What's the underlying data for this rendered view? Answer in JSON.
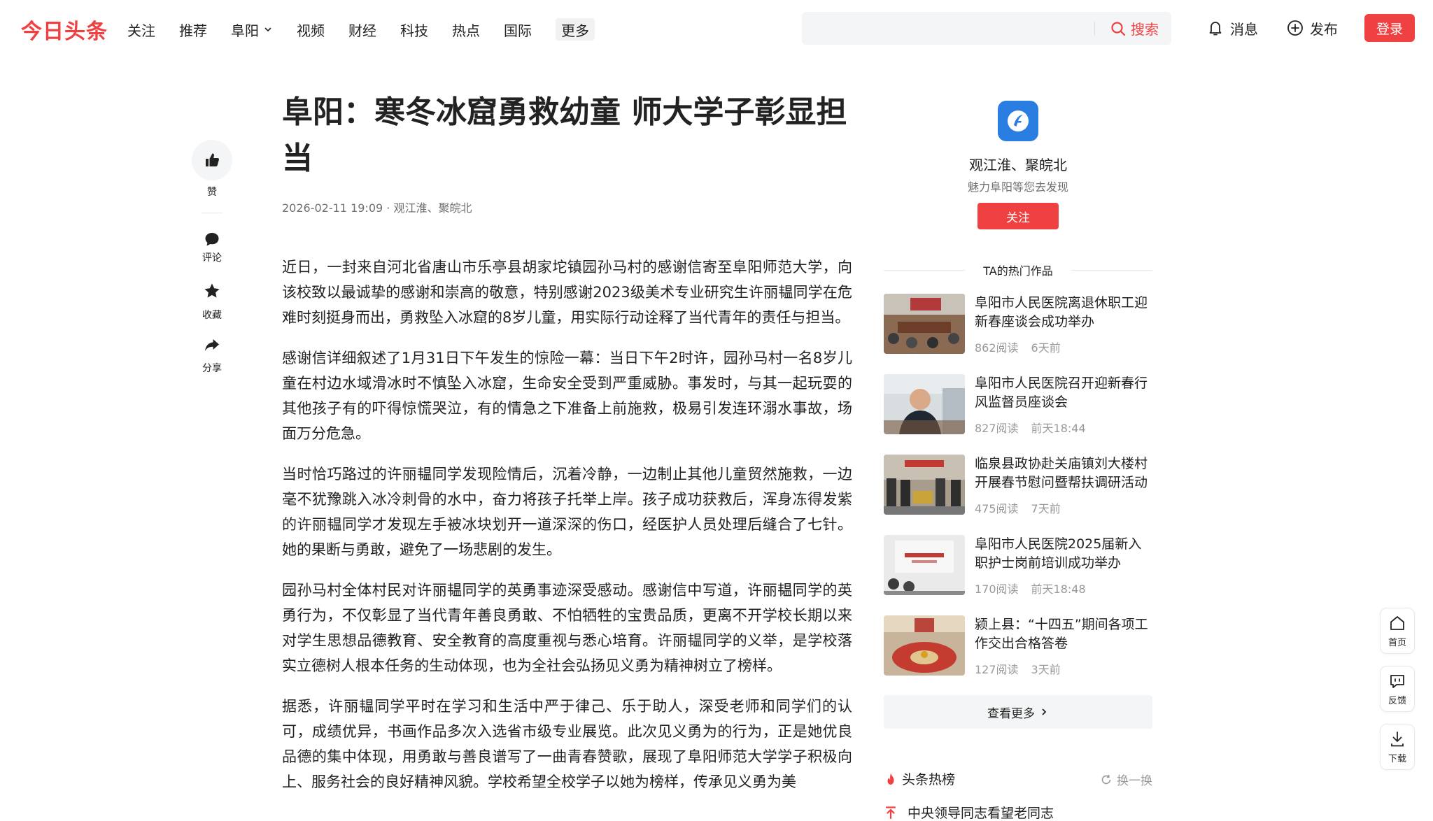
{
  "header": {
    "logo": "今日头条",
    "nav": [
      "关注",
      "推荐",
      "阜阳",
      "视频",
      "财经",
      "科技",
      "热点",
      "国际",
      "更多"
    ],
    "search": {
      "placeholder": "",
      "button": "搜索"
    },
    "messages": "消息",
    "publish": "发布",
    "login": "登录"
  },
  "rail": {
    "like": "赞",
    "comment": "评论",
    "collect": "收藏",
    "share": "分享"
  },
  "article": {
    "title": "阜阳：寒冬冰窟勇救幼童 师大学子彰显担当",
    "date": "2026-02-11 19:09",
    "source": "观江淮、聚皖北",
    "paragraphs": [
      "近日，一封来自河北省唐山市乐亭县胡家坨镇园孙马村的感谢信寄至阜阳师范大学，向该校致以最诚挚的感谢和崇高的敬意，特别感谢2023级美术专业研究生许丽韫同学在危难时刻挺身而出，勇救坠入冰窟的8岁儿童，用实际行动诠释了当代青年的责任与担当。",
      "感谢信详细叙述了1月31日下午发生的惊险一幕：当日下午2时许，园孙马村一名8岁儿童在村边水域滑冰时不慎坠入冰窟，生命安全受到严重威胁。事发时，与其一起玩耍的其他孩子有的吓得惊慌哭泣，有的情急之下准备上前施救，极易引发连环溺水事故，场面万分危急。",
      "当时恰巧路过的许丽韫同学发现险情后，沉着冷静，一边制止其他儿童贸然施救，一边毫不犹豫跳入冰冷刺骨的水中，奋力将孩子托举上岸。孩子成功获救后，浑身冻得发紫的许丽韫同学才发现左手被冰块划开一道深深的伤口，经医护人员处理后缝合了七针。她的果断与勇敢，避免了一场悲剧的发生。",
      "园孙马村全体村民对许丽韫同学的英勇事迹深受感动。感谢信中写道，许丽韫同学的英勇行为，不仅彰显了当代青年善良勇敢、不怕牺牲的宝贵品质，更离不开学校长期以来对学生思想品德教育、安全教育的高度重视与悉心培育。许丽韫同学的义举，是学校落实立德树人根本任务的生动体现，也为全社会弘扬见义勇为精神树立了榜样。",
      "据悉，许丽韫同学平时在学习和生活中严于律己、乐于助人，深受老师和同学们的认可，成绩优异，书画作品多次入选省市级专业展览。此次见义勇为的行为，正是她优良品德的集中体现，用勇敢与善良谱写了一曲青春赞歌，展现了阜阳师范大学学子积极向上、服务社会的良好精神风貌。学校希望全校学子以她为榜样，传承见义勇为美"
    ]
  },
  "author": {
    "name": "观江淮、聚皖北",
    "desc": "魅力阜阳等您去发现",
    "follow": "关注"
  },
  "works": {
    "heading": "TA的热门作品",
    "items": [
      {
        "title": "阜阳市人民医院离退休职工迎新春座谈会成功举办",
        "reads": "862阅读",
        "time": "6天前"
      },
      {
        "title": "阜阳市人民医院召开迎新春行风监督员座谈会",
        "reads": "827阅读",
        "time": "前天18:44"
      },
      {
        "title": "临泉县政协赴关庙镇刘大楼村开展春节慰问暨帮扶调研活动",
        "reads": "475阅读",
        "time": "7天前"
      },
      {
        "title": "阜阳市人民医院2025届新入职护士岗前培训成功举办",
        "reads": "170阅读",
        "time": "前天18:48"
      },
      {
        "title": "颍上县：“十四五”期间各项工作交出合格答卷",
        "reads": "127阅读",
        "time": "3天前"
      }
    ],
    "more": "查看更多"
  },
  "hot": {
    "title": "头条热榜",
    "refresh": "换一换",
    "first_item": "中央领导同志看望老同志"
  },
  "float_tools": {
    "home": "首页",
    "feedback": "反馈",
    "download": "下载"
  },
  "colors": {
    "brand_red": "#f04142",
    "text": "#222222",
    "muted": "#999999",
    "panel": "#f4f5f6"
  }
}
